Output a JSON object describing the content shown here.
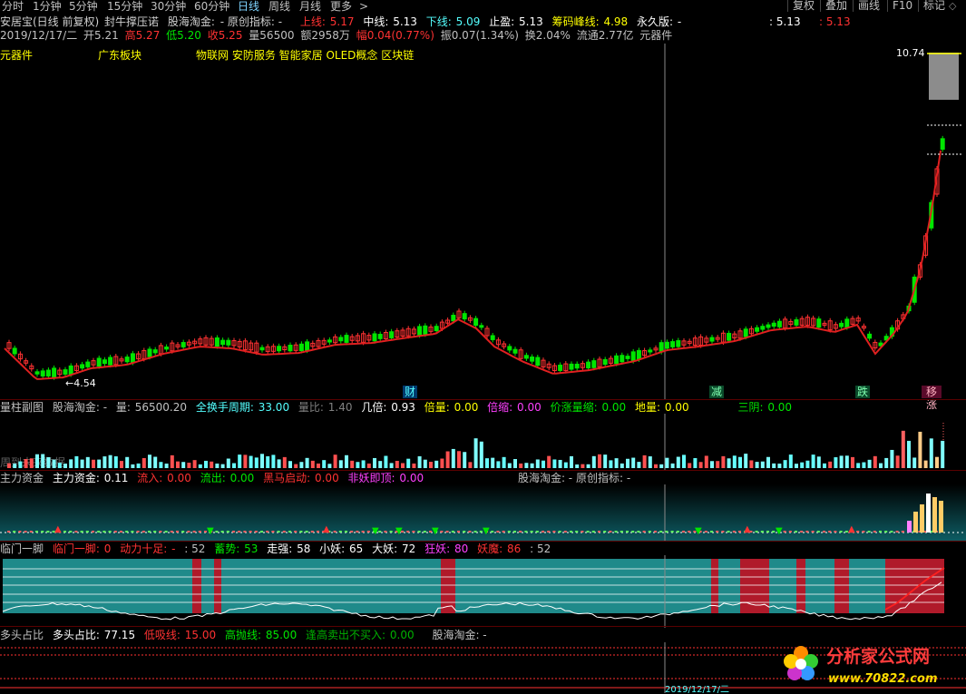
{
  "toolbar": {
    "periods": [
      "分时",
      "1分钟",
      "5分钟",
      "15分钟",
      "30分钟",
      "60分钟",
      "日线",
      "周线",
      "月线",
      "更多"
    ],
    "active_period": "日线",
    "more_arrow": ">",
    "right_buttons": [
      "复权",
      "叠加",
      "画线",
      "F10",
      "标记"
    ]
  },
  "main_panel": {
    "title": "安居宝(日线 前复权)",
    "indicator_name": "封牛撑压诺",
    "custom_indicator": "股海淘金:",
    "custom_value": "- 原创指标: -",
    "upper_label": "上线:",
    "upper_value": "5.17",
    "mid_label": "中线:",
    "mid_value": "5.13",
    "lower_label": "下线:",
    "lower_value": "5.09",
    "stop_label": "止盈:",
    "stop_value": "5.13",
    "chip_label": "筹码峰线:",
    "chip_value": "4.98",
    "forever_label": "永久版:",
    "forever_value": "-",
    "right_value1": ": 5.13",
    "right_value2": ": 5.13",
    "info_line": {
      "date": "2019/12/17/二",
      "open": "开5.21",
      "high": "高5.27",
      "low": "低5.20",
      "close": "收5.25",
      "vol": "量56500",
      "amount": "额2958万",
      "change": "幅0.04(0.77%)",
      "amp": "振0.07(1.34%)",
      "turn": "换2.04%",
      "float": "流通2.77亿",
      "category": "元器件"
    },
    "tags": [
      "元器件",
      "广东板块",
      "物联网 安防服务 智能家居 OLED概念 区块链"
    ],
    "high_price": "10.74",
    "low_price": "4.54",
    "event_labels": [
      "财",
      "减",
      "跌",
      "涨"
    ]
  },
  "volume_panel": {
    "name": "量柱副图",
    "custom": "股海淘金: -",
    "vol_label": "量:",
    "vol_value": "56500.20",
    "cycle_label": "全换手周期:",
    "cycle_value": "33.00",
    "ratio_label": "量比:",
    "ratio_value": "1.40",
    "times_label": "几倍:",
    "times_value": "0.93",
    "double_label": "倍量:",
    "double_value": "0.00",
    "shrink_label": "倍缩:",
    "shrink_value": "0.00",
    "pv_label": "价涨量缩:",
    "pv_value": "0.00",
    "ground_label": "地量:",
    "ground_value": "0.00",
    "three_label": "三阴:",
    "three_value": "0.00",
    "watermark": "周到未来数据"
  },
  "capital_panel": {
    "name": "主力资金",
    "main_label": "主力资金:",
    "main_value": "0.11",
    "in_label": "流入:",
    "in_value": "0.00",
    "out_label": "流出:",
    "out_value": "0.00",
    "horse_label": "黑马启动:",
    "horse_value": "0.00",
    "demon_label": "非妖即顶:",
    "demon_value": "0.00",
    "custom": "股海淘金: - 原创指标: -"
  },
  "door_panel": {
    "name": "临门一脚",
    "main_label": "临门一脚:",
    "main_value": "0",
    "power_label": "动力十足:",
    "power_value": "-",
    "v52": ": 52",
    "store_label": "蓄势:",
    "store_value": "53",
    "strong_label": "走强:",
    "strong_value": "58",
    "small_label": "小妖:",
    "small_value": "65",
    "big_label": "大妖:",
    "big_value": "72",
    "crazy_label": "狂妖:",
    "crazy_value": "80",
    "demon_label": "妖魔:",
    "demon_value": "86",
    "tail": ": 52"
  },
  "bull_panel": {
    "name": "多头占比",
    "main_label": "多头占比:",
    "main_value": "77.15",
    "low_label": "低吸线:",
    "low_value": "15.00",
    "high_label": "高抛线:",
    "high_value": "85.00",
    "sell_label": "逢高卖出不买入:",
    "sell_value": "0.00",
    "custom": "股海淘金: -"
  },
  "bottom_date": "2019/12/17/二",
  "logo": {
    "text": "分析家公式网",
    "url": "www.70822.com"
  },
  "colors": {
    "up": "#ff3232",
    "down": "#00e600",
    "accent": "#54ffff",
    "panel_teal": "#1f8a8a"
  }
}
